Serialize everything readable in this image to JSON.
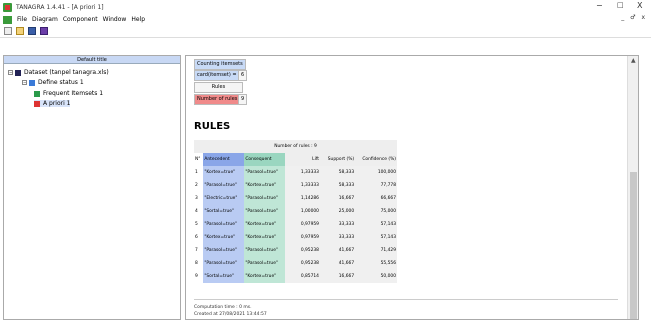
{
  "window": {
    "title": "TANAGRA 1.4.41 - [A priori 1]",
    "controls": [
      "−",
      "□",
      "X"
    ],
    "mdi_controls": "_ ♂ x"
  },
  "menu": [
    "File",
    "Diagram",
    "Component",
    "Window",
    "Help"
  ],
  "left_panel": {
    "header": "Default title",
    "tree": [
      {
        "label": "Dataset (tanpel tanagra.xls)",
        "icon": "table-icon"
      },
      {
        "label": "Define status 1",
        "icon": "status-icon"
      },
      {
        "label": "Frequent Itemsets 1",
        "icon": "itemset-icon"
      },
      {
        "label": "A priori 1",
        "icon": "apriori-icon"
      }
    ]
  },
  "right_panel": {
    "summary": {
      "counting_itemsets": "Counting itemsets",
      "card_label": "card(itemset) = 2",
      "card_value": "6",
      "rules_label": "Rules",
      "num_rules_label": "Number of rules",
      "num_rules_value": "9"
    },
    "rules_title": "RULES",
    "table": {
      "caption": "Number of rules : 9",
      "headers": [
        "N°",
        "Antecedent",
        "Consequent",
        "Lift",
        "Support (%)",
        "Confidence (%)"
      ],
      "rows": [
        [
          "1",
          "\"Kortex=true\"",
          "\"Parasol=true\"",
          "1,33333",
          "58,333",
          "100,000"
        ],
        [
          "2",
          "\"Parasol=true\"",
          "\"Kortex=true\"",
          "1,33333",
          "58,333",
          "77,778"
        ],
        [
          "3",
          "\"Electric=true\"",
          "\"Parasol=true\"",
          "1,14286",
          "16,667",
          "66,667"
        ],
        [
          "4",
          "\"Sortal=true\"",
          "\"Parasol=true\"",
          "1,00000",
          "25,000",
          "75,000"
        ],
        [
          "5",
          "\"Parasol=true\"",
          "\"Kortex=true\"",
          "0,97959",
          "33,333",
          "57,143"
        ],
        [
          "6",
          "\"Kortex=true\"",
          "\"Kortex=true\"",
          "0,97959",
          "33,333",
          "57,143"
        ],
        [
          "7",
          "\"Parasol=true\"",
          "\"Parasol=true\"",
          "0,95238",
          "41,667",
          "71,429"
        ],
        [
          "8",
          "\"Parasol=true\"",
          "\"Parasol=true\"",
          "0,95238",
          "41,667",
          "55,556"
        ],
        [
          "9",
          "\"Sortal=true\"",
          "\"Kortex=true\"",
          "0,85714",
          "16,667",
          "50,000"
        ]
      ]
    },
    "computation_time": "Computation time : 0 ms.",
    "created_at": "Created at 27/08/2021 13:44:57"
  }
}
